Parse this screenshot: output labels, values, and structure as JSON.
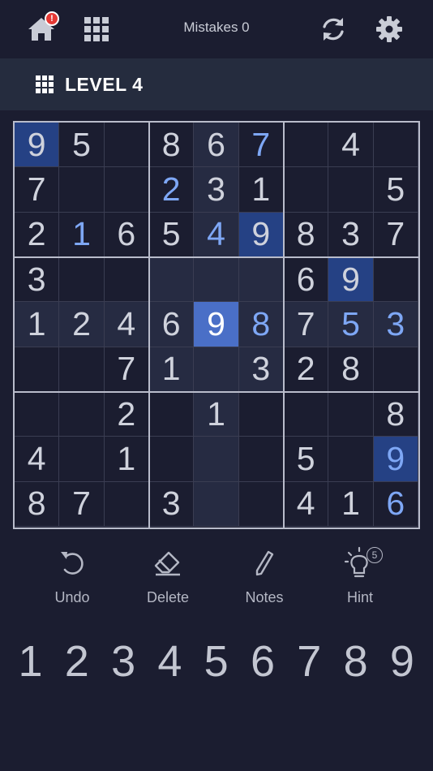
{
  "header": {
    "home_icon": "home-icon",
    "notification_badge": "!",
    "mistakes_label": "Mistakes 0",
    "refresh_icon": "refresh-icon",
    "settings_icon": "gear-icon"
  },
  "level": {
    "label": "LEVEL 4"
  },
  "board": {
    "rows": [
      [
        "9",
        "5",
        "",
        "8",
        "6",
        "7",
        "",
        "4",
        ""
      ],
      [
        "7",
        "",
        "",
        "2",
        "3",
        "1",
        "",
        "",
        "5"
      ],
      [
        "2",
        "1",
        "6",
        "5",
        "4",
        "9",
        "8",
        "3",
        "7"
      ],
      [
        "3",
        "",
        "",
        "",
        "",
        "",
        "6",
        "9",
        ""
      ],
      [
        "1",
        "2",
        "4",
        "6",
        "9",
        "8",
        "7",
        "5",
        "3"
      ],
      [
        "",
        "",
        "7",
        "1",
        "",
        "3",
        "2",
        "8",
        ""
      ],
      [
        "",
        "",
        "2",
        "",
        "1",
        "",
        "",
        "",
        "8"
      ],
      [
        "4",
        "",
        "1",
        "",
        "",
        "",
        "5",
        "",
        "9"
      ],
      [
        "8",
        "7",
        "",
        "3",
        "",
        "",
        "4",
        "1",
        "6"
      ]
    ],
    "user_entered": [
      [
        0,
        5
      ],
      [
        1,
        3
      ],
      [
        2,
        1
      ],
      [
        2,
        4
      ],
      [
        4,
        4
      ],
      [
        4,
        5
      ],
      [
        4,
        7
      ],
      [
        4,
        8
      ],
      [
        7,
        8
      ],
      [
        8,
        8
      ]
    ],
    "selected": [
      4,
      4
    ],
    "selected_value": "9",
    "colors": {
      "highlight": "#262b42",
      "same_number": "#254184",
      "selected": "#4a6fc7",
      "user_digit": "#7ea7f5"
    }
  },
  "tools": [
    {
      "id": "undo",
      "label": "Undo",
      "icon": "undo-icon"
    },
    {
      "id": "delete",
      "label": "Delete",
      "icon": "eraser-icon"
    },
    {
      "id": "notes",
      "label": "Notes",
      "icon": "pencil-icon"
    },
    {
      "id": "hint",
      "label": "Hint",
      "icon": "lightbulb-icon",
      "count": "5"
    }
  ],
  "numpad": [
    "1",
    "2",
    "3",
    "4",
    "5",
    "6",
    "7",
    "8",
    "9"
  ]
}
